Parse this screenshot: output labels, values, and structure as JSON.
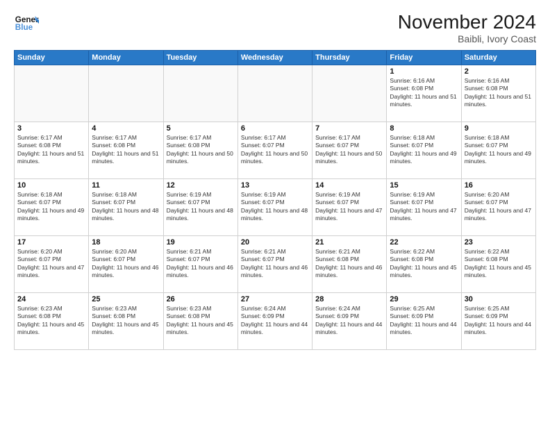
{
  "logo": {
    "line1": "General",
    "line2": "Blue"
  },
  "title": "November 2024",
  "location": "Baibli, Ivory Coast",
  "weekdays": [
    "Sunday",
    "Monday",
    "Tuesday",
    "Wednesday",
    "Thursday",
    "Friday",
    "Saturday"
  ],
  "weeks": [
    [
      {
        "day": "",
        "info": ""
      },
      {
        "day": "",
        "info": ""
      },
      {
        "day": "",
        "info": ""
      },
      {
        "day": "",
        "info": ""
      },
      {
        "day": "",
        "info": ""
      },
      {
        "day": "1",
        "info": "Sunrise: 6:16 AM\nSunset: 6:08 PM\nDaylight: 11 hours and 51 minutes."
      },
      {
        "day": "2",
        "info": "Sunrise: 6:16 AM\nSunset: 6:08 PM\nDaylight: 11 hours and 51 minutes."
      }
    ],
    [
      {
        "day": "3",
        "info": "Sunrise: 6:17 AM\nSunset: 6:08 PM\nDaylight: 11 hours and 51 minutes."
      },
      {
        "day": "4",
        "info": "Sunrise: 6:17 AM\nSunset: 6:08 PM\nDaylight: 11 hours and 51 minutes."
      },
      {
        "day": "5",
        "info": "Sunrise: 6:17 AM\nSunset: 6:08 PM\nDaylight: 11 hours and 50 minutes."
      },
      {
        "day": "6",
        "info": "Sunrise: 6:17 AM\nSunset: 6:07 PM\nDaylight: 11 hours and 50 minutes."
      },
      {
        "day": "7",
        "info": "Sunrise: 6:17 AM\nSunset: 6:07 PM\nDaylight: 11 hours and 50 minutes."
      },
      {
        "day": "8",
        "info": "Sunrise: 6:18 AM\nSunset: 6:07 PM\nDaylight: 11 hours and 49 minutes."
      },
      {
        "day": "9",
        "info": "Sunrise: 6:18 AM\nSunset: 6:07 PM\nDaylight: 11 hours and 49 minutes."
      }
    ],
    [
      {
        "day": "10",
        "info": "Sunrise: 6:18 AM\nSunset: 6:07 PM\nDaylight: 11 hours and 49 minutes."
      },
      {
        "day": "11",
        "info": "Sunrise: 6:18 AM\nSunset: 6:07 PM\nDaylight: 11 hours and 48 minutes."
      },
      {
        "day": "12",
        "info": "Sunrise: 6:19 AM\nSunset: 6:07 PM\nDaylight: 11 hours and 48 minutes."
      },
      {
        "day": "13",
        "info": "Sunrise: 6:19 AM\nSunset: 6:07 PM\nDaylight: 11 hours and 48 minutes."
      },
      {
        "day": "14",
        "info": "Sunrise: 6:19 AM\nSunset: 6:07 PM\nDaylight: 11 hours and 47 minutes."
      },
      {
        "day": "15",
        "info": "Sunrise: 6:19 AM\nSunset: 6:07 PM\nDaylight: 11 hours and 47 minutes."
      },
      {
        "day": "16",
        "info": "Sunrise: 6:20 AM\nSunset: 6:07 PM\nDaylight: 11 hours and 47 minutes."
      }
    ],
    [
      {
        "day": "17",
        "info": "Sunrise: 6:20 AM\nSunset: 6:07 PM\nDaylight: 11 hours and 47 minutes."
      },
      {
        "day": "18",
        "info": "Sunrise: 6:20 AM\nSunset: 6:07 PM\nDaylight: 11 hours and 46 minutes."
      },
      {
        "day": "19",
        "info": "Sunrise: 6:21 AM\nSunset: 6:07 PM\nDaylight: 11 hours and 46 minutes."
      },
      {
        "day": "20",
        "info": "Sunrise: 6:21 AM\nSunset: 6:07 PM\nDaylight: 11 hours and 46 minutes."
      },
      {
        "day": "21",
        "info": "Sunrise: 6:21 AM\nSunset: 6:08 PM\nDaylight: 11 hours and 46 minutes."
      },
      {
        "day": "22",
        "info": "Sunrise: 6:22 AM\nSunset: 6:08 PM\nDaylight: 11 hours and 45 minutes."
      },
      {
        "day": "23",
        "info": "Sunrise: 6:22 AM\nSunset: 6:08 PM\nDaylight: 11 hours and 45 minutes."
      }
    ],
    [
      {
        "day": "24",
        "info": "Sunrise: 6:23 AM\nSunset: 6:08 PM\nDaylight: 11 hours and 45 minutes."
      },
      {
        "day": "25",
        "info": "Sunrise: 6:23 AM\nSunset: 6:08 PM\nDaylight: 11 hours and 45 minutes."
      },
      {
        "day": "26",
        "info": "Sunrise: 6:23 AM\nSunset: 6:08 PM\nDaylight: 11 hours and 45 minutes."
      },
      {
        "day": "27",
        "info": "Sunrise: 6:24 AM\nSunset: 6:09 PM\nDaylight: 11 hours and 44 minutes."
      },
      {
        "day": "28",
        "info": "Sunrise: 6:24 AM\nSunset: 6:09 PM\nDaylight: 11 hours and 44 minutes."
      },
      {
        "day": "29",
        "info": "Sunrise: 6:25 AM\nSunset: 6:09 PM\nDaylight: 11 hours and 44 minutes."
      },
      {
        "day": "30",
        "info": "Sunrise: 6:25 AM\nSunset: 6:09 PM\nDaylight: 11 hours and 44 minutes."
      }
    ]
  ]
}
